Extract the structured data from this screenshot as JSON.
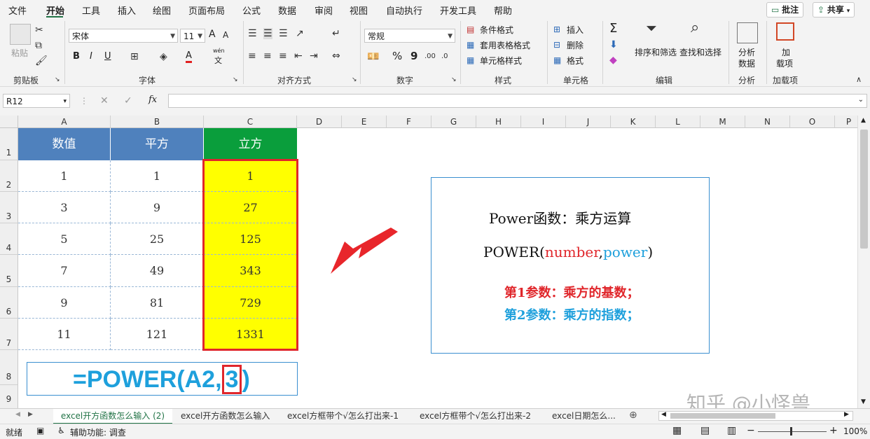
{
  "menu": {
    "items": [
      "文件",
      "开始",
      "工具",
      "插入",
      "绘图",
      "页面布局",
      "公式",
      "数据",
      "审阅",
      "视图",
      "自动执行",
      "开发工具",
      "帮助"
    ],
    "comment_label": "批注",
    "share_label": "共享"
  },
  "ribbon": {
    "clipboard": {
      "paste_label": "粘贴",
      "group_label": "剪贴板"
    },
    "font": {
      "font_name": "宋体",
      "font_size": "11",
      "group_label": "字体",
      "bold": "B",
      "italic": "I",
      "underline": "U",
      "grow": "A",
      "shrink": "A",
      "color_a": "A",
      "wen": "wén",
      "wen2": "文"
    },
    "alignment": {
      "group_label": "对齐方式"
    },
    "number": {
      "format": "常规",
      "group_label": "数字",
      "percent": "%",
      "comma": "9"
    },
    "styles": {
      "conditional": "条件格式",
      "table_format": "套用表格格式",
      "cell_styles": "单元格样式",
      "group_label": "样式"
    },
    "cells": {
      "insert": "插入",
      "delete": "删除",
      "format": "格式",
      "group_label": "单元格"
    },
    "editing": {
      "sort_filter": "排序和筛选",
      "find_select": "查找和选择",
      "group_label": "编辑",
      "sigma": "Σ"
    },
    "analysis": {
      "analyze_line1": "分析",
      "analyze_line2": "数据",
      "group_label": "分析"
    },
    "addins": {
      "line1": "加",
      "line2": "载项",
      "group_label": "加载项"
    }
  },
  "formula_bar": {
    "name_box": "R12",
    "fx": "fx",
    "cancel": "✕",
    "enter": "✓",
    "value": ""
  },
  "grid": {
    "columns": [
      "A",
      "B",
      "C",
      "D",
      "E",
      "F",
      "G",
      "H",
      "I",
      "J",
      "K",
      "L",
      "M",
      "N",
      "O",
      "P"
    ],
    "rows": [
      "1",
      "2",
      "3",
      "4",
      "5",
      "6",
      "7",
      "8",
      "9"
    ],
    "table_headers": [
      "数值",
      "平方",
      "立方"
    ],
    "table_rows": [
      [
        "1",
        "1",
        "1"
      ],
      [
        "3",
        "9",
        "27"
      ],
      [
        "5",
        "25",
        "125"
      ],
      [
        "7",
        "49",
        "343"
      ],
      [
        "9",
        "81",
        "729"
      ],
      [
        "11",
        "121",
        "1331"
      ]
    ],
    "formula_display": {
      "prefix": "=POWER(A2,",
      "boxed": "3",
      "suffix": ")"
    }
  },
  "info_box": {
    "title": "Power函数：乘方运算",
    "syntax_fn": "POWER(",
    "syntax_arg1": "number",
    "syntax_comma": ",",
    "syntax_arg2": "power",
    "syntax_close": ")",
    "note1": "第1参数：乘方的基数；",
    "note2": "第2参数：乘方的指数；"
  },
  "watermark": "知乎 @小怪兽",
  "sheet_tabs": [
    "excel开方函数怎么输入 (2)",
    "excel开方函数怎么输入",
    "excel方框带个√怎么打出来-1",
    "excel方框带个√怎么打出来-2",
    "excel日期怎么..."
  ],
  "status": {
    "ready": "就绪",
    "accessibility": "辅助功能: 调查",
    "zoom": "100%"
  },
  "colors": {
    "header_blue": "#4f81bd",
    "header_green": "#0a9e3c",
    "highlight_yellow": "#ffff00",
    "red_border": "#e0262b",
    "formula_blue": "#1ea0dc",
    "accent_green": "#217346"
  }
}
